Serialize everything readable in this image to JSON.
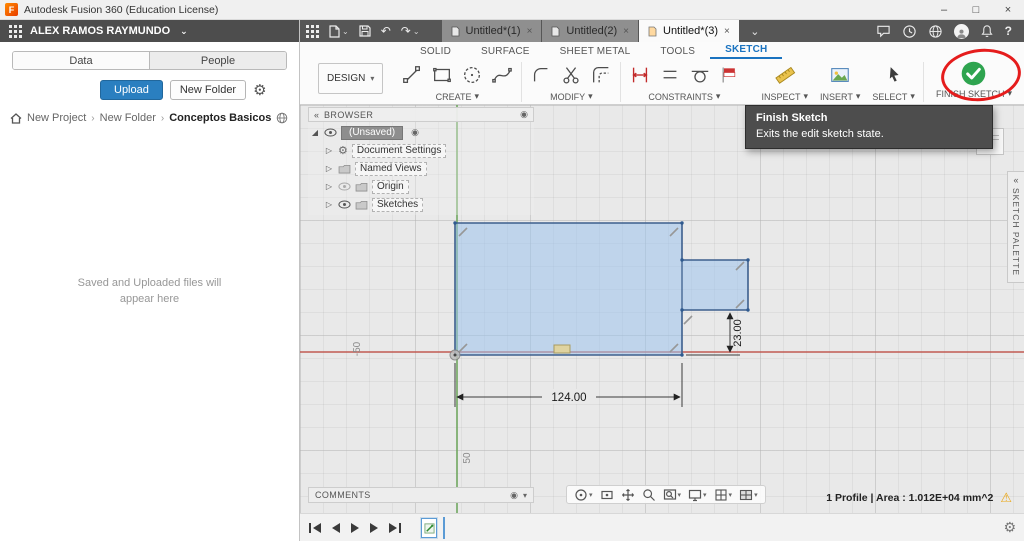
{
  "icons": {
    "logo_letter": "F",
    "minimize": "–",
    "maximize": "□",
    "close": "×",
    "caret_down": "▾",
    "chevron_down": "⌄",
    "chevron_right": "▷",
    "root_expander": "◢",
    "undo": "↶",
    "redo": "↷",
    "gear": "⚙",
    "warning": "⚠",
    "collapse": "«",
    "target_dot": "◉",
    "help": "?",
    "crumb_sep": "›"
  },
  "titlebar": {
    "title": "Autodesk Fusion 360 (Education License)"
  },
  "data_panel": {
    "user": "ALEX RAMOS RAYMUNDO",
    "tab_data": "Data",
    "tab_people": "People",
    "upload": "Upload",
    "new_folder": "New Folder",
    "breadcrumb": {
      "item1": "New Project",
      "item2": "New Folder",
      "item3": "Conceptos Basicos"
    },
    "empty1": "Saved and Uploaded files will",
    "empty2": "appear here"
  },
  "doc_tabs": {
    "tab1": "Untitled*(1)",
    "tab2": "Untitled(2)",
    "tab3": "Untitled*(3)"
  },
  "ribbon": {
    "design": "DESIGN",
    "tab_solid": "SOLID",
    "tab_surface": "SURFACE",
    "tab_sheetmetal": "SHEET METAL",
    "tab_tools": "TOOLS",
    "tab_sketch": "SKETCH",
    "group_create": "CREATE",
    "group_modify": "MODIFY",
    "group_constraints": "CONSTRAINTS",
    "group_inspect": "INSPECT",
    "group_insert": "INSERT",
    "group_select": "SELECT",
    "finish_sketch": "FINISH SKETCH"
  },
  "tooltip": {
    "title": "Finish Sketch",
    "body": "Exits the edit sketch state."
  },
  "browser": {
    "header": "BROWSER",
    "root": "(Unsaved)",
    "item_doc_settings": "Document Settings",
    "item_named_views": "Named Views",
    "item_origin": "Origin",
    "item_sketches": "Sketches"
  },
  "canvas": {
    "dim_width": "124.00",
    "dim_height": "23.00",
    "axis_neg50": "-50",
    "axis_50": "50"
  },
  "sketch_palette": "SKETCH PALETTE",
  "comments": "COMMENTS",
  "status": "1 Profile | Area : 1.012E+04 mm^2"
}
